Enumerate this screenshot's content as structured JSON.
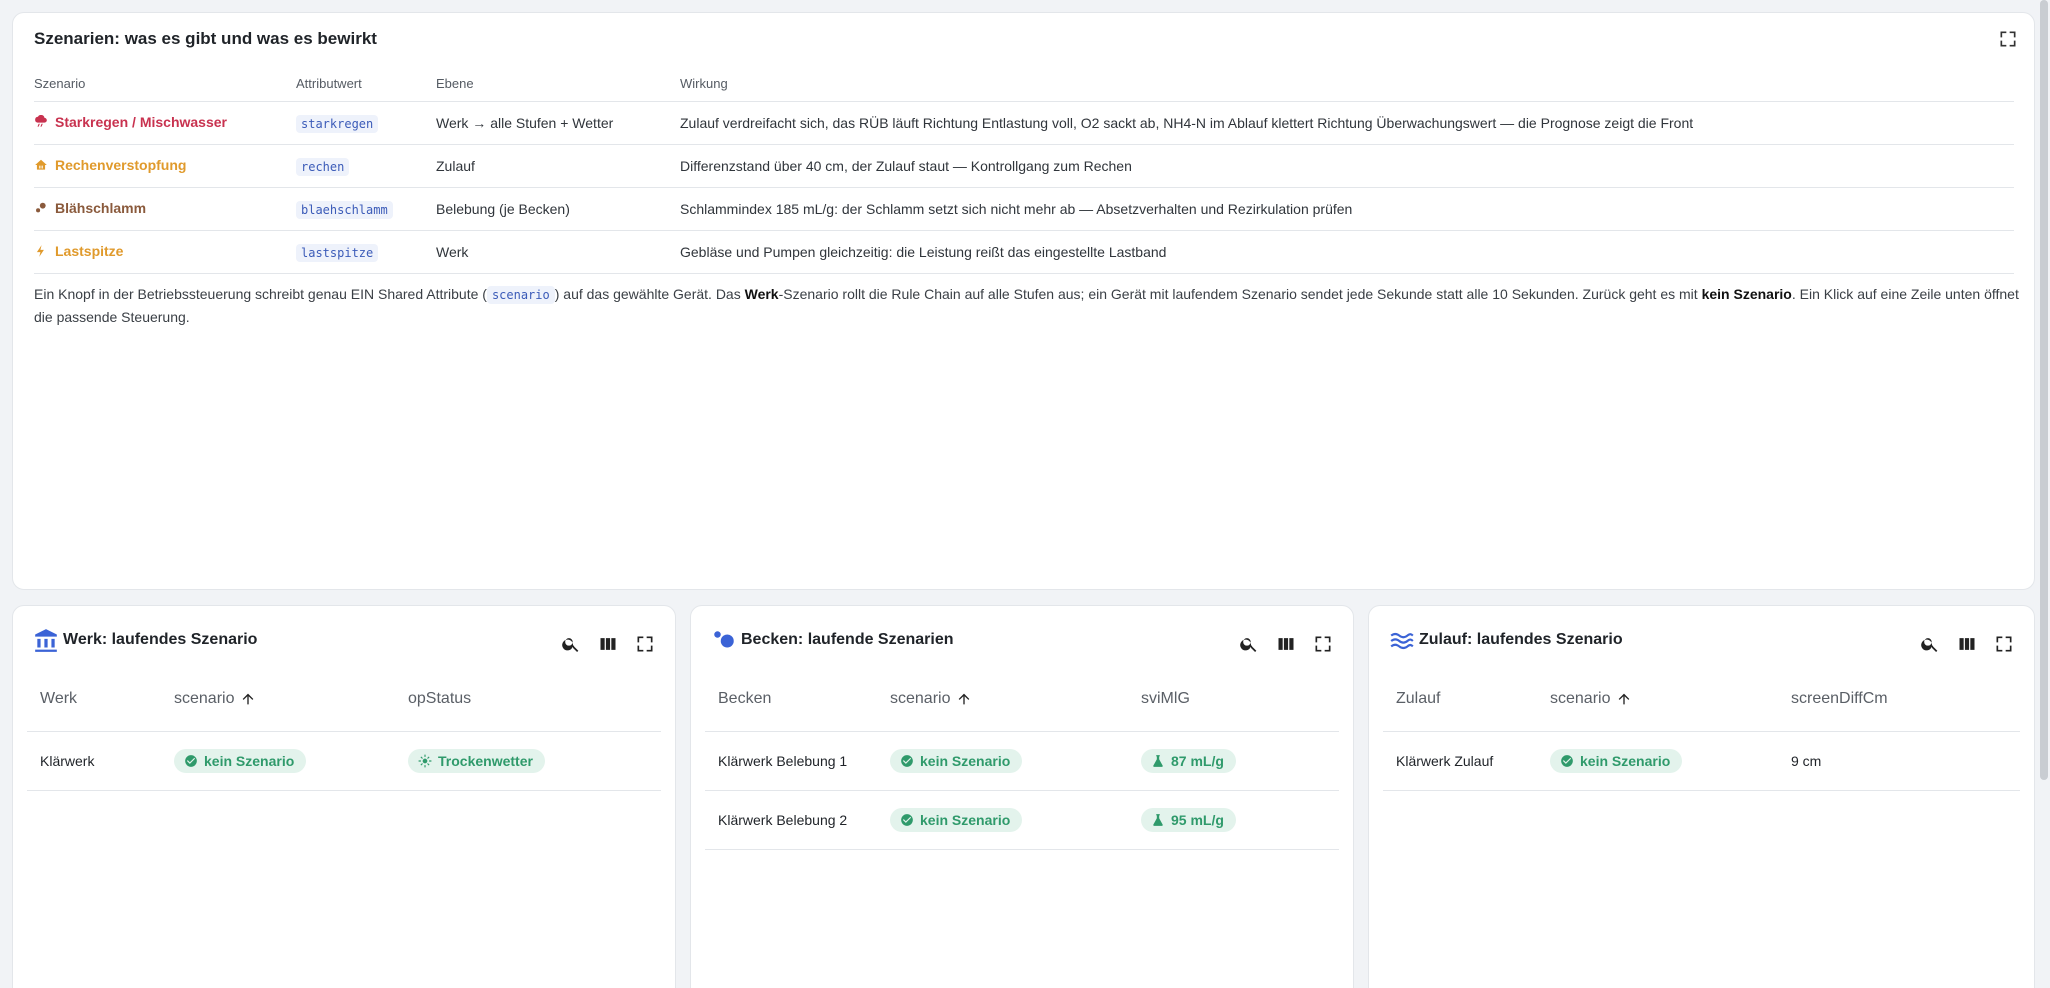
{
  "scenarios_card": {
    "title": "Szenarien: was es gibt und was es bewirkt",
    "columns": [
      "Szenario",
      "Attributwert",
      "Ebene",
      "Wirkung"
    ],
    "rows": [
      {
        "name": "Starkregen / Mischwasser",
        "icon": "heavy-rain-icon",
        "color": "#c8324f",
        "attr": "starkregen",
        "level": "Werk → alle Stufen + Wetter",
        "effect": "Zulauf verdreifacht sich, das RÜB läuft Richtung Entlastung voll, O2 sackt ab, NH4-N im Ablauf klettert Richtung Überwachungswert — die Prognose zeigt die Front"
      },
      {
        "name": "Rechenverstopfung",
        "icon": "screen-icon",
        "color": "#e09a2c",
        "attr": "rechen",
        "level": "Zulauf",
        "effect": "Differenzstand über 40 cm, der Zulauf staut — Kontrollgang zum Rechen"
      },
      {
        "name": "Blähschlamm",
        "icon": "bubbles-icon",
        "color": "#8a5a3c",
        "attr": "blaehschlamm",
        "level": "Belebung (je Becken)",
        "effect": "Schlammindex 185 mL/g: der Schlamm setzt sich nicht mehr ab — Absetzverhalten und Rezirkulation prüfen"
      },
      {
        "name": "Lastspitze",
        "icon": "lightning-icon",
        "color": "#e09a2c",
        "attr": "lastspitze",
        "level": "Werk",
        "effect": "Gebläse und Pumpen gleichzeitig: die Leistung reißt das eingestellte Lastband"
      }
    ],
    "desc": {
      "p1": "Ein Knopf in der Betriebssteuerung schreibt genau EIN Shared Attribute (",
      "code": "scenario",
      "p2": ") auf das gewählte Gerät. Das ",
      "b1": "Werk",
      "p3": "-Szenario rollt die Rule Chain auf alle Stufen aus; ein Gerät mit laufendem Szenario sendet jede Sekunde statt alle 10 Sekunden. Zurück geht es mit ",
      "b2": "kein Szenario",
      "p4": ". Ein Klick auf eine Zeile unten öffnet die passende Steuerung."
    }
  },
  "werk_card": {
    "title": "Werk: laufendes Szenario",
    "icon": "building-icon",
    "columns": [
      "Werk",
      "scenario",
      "opStatus"
    ],
    "rows": [
      {
        "name": "Klärwerk",
        "scenario": "kein Szenario",
        "status": "Trockenwetter"
      }
    ]
  },
  "becken_card": {
    "title": "Becken: laufende Szenarien",
    "icon": "bubbles-icon",
    "columns": [
      "Becken",
      "scenario",
      "sviMlG"
    ],
    "rows": [
      {
        "name": "Klärwerk Belebung 1",
        "scenario": "kein Szenario",
        "svi": "87 mL/g"
      },
      {
        "name": "Klärwerk Belebung 2",
        "scenario": "kein Szenario",
        "svi": "95 mL/g"
      }
    ]
  },
  "zulauf_card": {
    "title": "Zulauf: laufendes Szenario",
    "icon": "waves-icon",
    "columns": [
      "Zulauf",
      "scenario",
      "screenDiffCm"
    ],
    "rows": [
      {
        "name": "Klärwerk Zulauf",
        "scenario": "kein Szenario",
        "diff": "9 cm"
      }
    ]
  },
  "colors": {
    "accent": "#3b63d6",
    "chip_bg": "#e3f3ec",
    "chip_text": "#2f9a6b"
  }
}
